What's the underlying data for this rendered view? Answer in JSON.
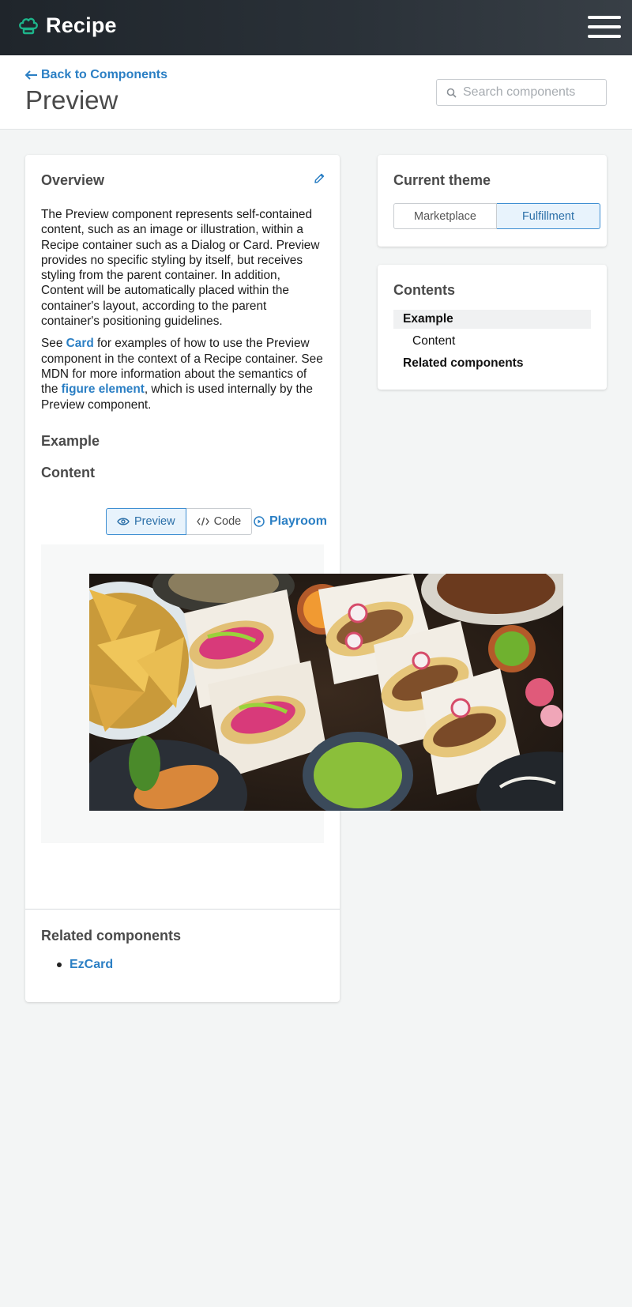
{
  "header": {
    "app_name": "Recipe",
    "logo_icon": "chef-hat-icon",
    "menu_icon": "hamburger-menu-icon"
  },
  "page": {
    "back_label": "Back to Components",
    "title": "Preview",
    "search_placeholder": "Search components"
  },
  "overview": {
    "title": "Overview",
    "para1": "The Preview component represents self-contained content, such as an image or illustration, within a Recipe container such as a Dialog or Card. Preview provides no specific styling by itself, but receives styling from the parent container. In addition, Content will be automatically placed within the container's layout, according to the parent container's positioning guidelines.",
    "para2_a": "See ",
    "para2_link": "Card",
    "para2_b": " for examples of how to use the Preview component in the context of a Recipe container. See MDN for more information about the semantics of the ",
    "para2_link2": "figure element",
    "para2_c": ", which is used internally by the Preview component.",
    "example_title": "Example",
    "content_title": "Content"
  },
  "tabs": {
    "preview": "Preview",
    "code": "Code",
    "playroom": "Playroom"
  },
  "related": {
    "title": "Related components",
    "items": [
      "EzCard"
    ]
  },
  "theme": {
    "title": "Current theme",
    "options": [
      "Marketplace",
      "Fulfillment"
    ],
    "selected": "Fulfillment"
  },
  "contents": {
    "title": "Contents",
    "items": [
      "Example",
      "Content",
      "Related components"
    ]
  },
  "colors": {
    "accent": "#2b7fc4",
    "header_bg": "#2a3138",
    "active_bg": "#e8f3fc"
  }
}
